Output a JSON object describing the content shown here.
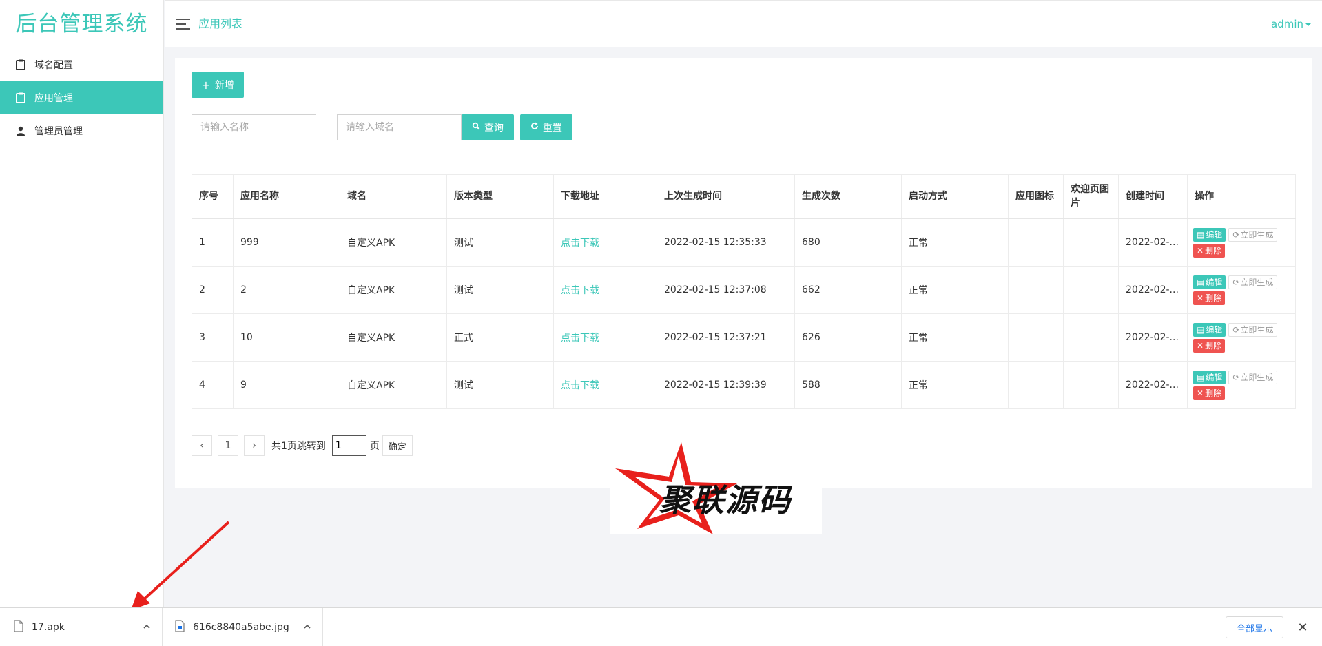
{
  "app": {
    "brand": "后台管理系统"
  },
  "sidebar": {
    "items": [
      {
        "label": "域名配置",
        "icon": "clipboard-icon",
        "active": false
      },
      {
        "label": "应用管理",
        "icon": "clipboard-icon",
        "active": true
      },
      {
        "label": "管理员管理",
        "icon": "user-icon",
        "active": false
      }
    ]
  },
  "header": {
    "breadcrumb": "应用列表",
    "user": "admin"
  },
  "toolbar": {
    "add_label": "新增",
    "name_placeholder": "请输入名称",
    "domain_placeholder": "请输入域名",
    "search_label": "查询",
    "reset_label": "重置"
  },
  "table": {
    "columns": [
      "序号",
      "应用名称",
      "域名",
      "版本类型",
      "下载地址",
      "上次生成时间",
      "生成次数",
      "启动方式",
      "应用图标",
      "欢迎页图片",
      "创建时间",
      "操作"
    ],
    "rows": [
      [
        "1",
        "999",
        "自定义APK",
        "测试",
        "点击下载",
        "2022-02-15 12:35:33",
        "680",
        "正常",
        "",
        "",
        "2022-02-..."
      ],
      [
        "2",
        "2",
        "自定义APK",
        "测试",
        "点击下载",
        "2022-02-15 12:37:08",
        "662",
        "正常",
        "",
        "",
        "2022-02-..."
      ],
      [
        "3",
        "10",
        "自定义APK",
        "正式",
        "点击下载",
        "2022-02-15 12:37:21",
        "626",
        "正常",
        "",
        "",
        "2022-02-..."
      ],
      [
        "4",
        "9",
        "自定义APK",
        "测试",
        "点击下载",
        "2022-02-15 12:39:39",
        "588",
        "正常",
        "",
        "",
        "2022-02-..."
      ]
    ],
    "ops": {
      "edit": "编辑",
      "generate": "立即生成",
      "delete": "删除"
    }
  },
  "pager": {
    "prev": "‹",
    "next": "›",
    "current_page": "1",
    "jump_text": "共1页跳转到",
    "jump_value": "1",
    "page_suffix": "页",
    "confirm": "确定"
  },
  "watermark": {
    "text": "聚联源码"
  },
  "downloads": {
    "files": [
      {
        "name": "17.apk",
        "icon": "file-icon"
      },
      {
        "name": "616c8840a5abe.jpg",
        "icon": "image-file-icon"
      }
    ],
    "show_all": "全部显示"
  },
  "colors": {
    "accent": "#3cc7b8",
    "danger": "#ef5350",
    "link": "#1a73e8"
  }
}
